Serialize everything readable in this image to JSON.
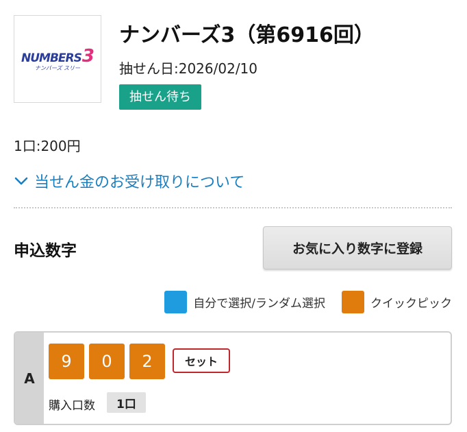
{
  "header": {
    "logo": {
      "word": "NUMBERS",
      "number": "3",
      "kana": "ナンバーズ スリー"
    },
    "title": "ナンバーズ3（第6916回）",
    "draw_date": "抽せん日:2026/02/10",
    "status": "抽せん待ち"
  },
  "price": "1口:200円",
  "prize_link": "当せん金のお受け取りについて",
  "selection": {
    "title": "申込数字",
    "favorite_button": "お気に入り数字に登録",
    "legend": [
      {
        "label": "自分で選択/ランダム選択",
        "color": "#1f9be0"
      },
      {
        "label": "クイックピック",
        "color": "#e07b0e"
      }
    ],
    "entries": [
      {
        "row": "A",
        "digits": [
          "9",
          "0",
          "2"
        ],
        "type": "セット",
        "quantity_label": "購入口数",
        "quantity": "1口"
      }
    ]
  },
  "colors": {
    "badge": "#1aa18a",
    "link": "#1a7fc1",
    "quickpick": "#e07b0e",
    "set_border": "#c0272d"
  }
}
